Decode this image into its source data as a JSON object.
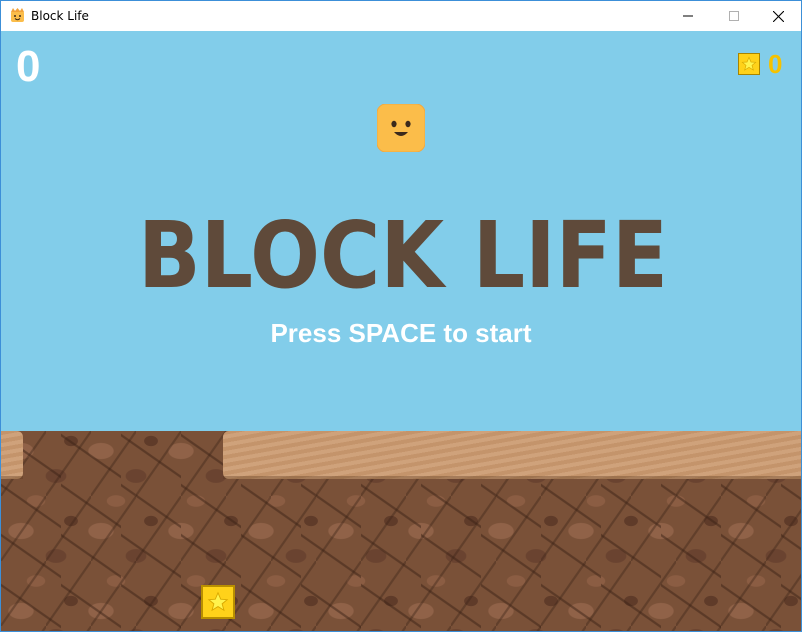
{
  "window": {
    "title": "Block Life",
    "icon": "crown-smiley-icon"
  },
  "hud": {
    "score": "0",
    "coins": "0",
    "coin_icon": "star-coin-icon"
  },
  "title_screen": {
    "game_title": "BLOCK LIFE",
    "prompt": "Press SPACE to start"
  },
  "colors": {
    "sky": "#82cdea",
    "title": "#5f4a3a",
    "player": "#fbbd4a",
    "coin": "#ffd21a",
    "coin_text": "#f5c200",
    "dirt": "#7a5138",
    "sand": "#c99a72"
  }
}
